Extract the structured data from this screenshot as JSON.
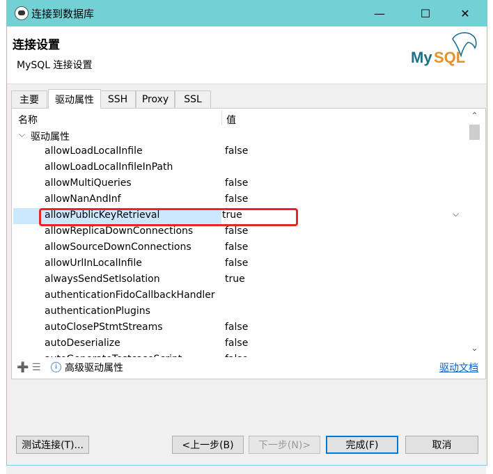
{
  "window": {
    "title": "连接到数据库",
    "minimize_icon": "minimize-icon",
    "maximize_icon": "maximize-icon",
    "close_icon": "close-icon",
    "titlebar_color": "#73d1d6"
  },
  "header": {
    "title": "连接设置",
    "subtitle": "MySQL 连接设置",
    "logo_text": "MySQL"
  },
  "tabs": [
    {
      "label": "主要",
      "active": false
    },
    {
      "label": "驱动属性",
      "active": true
    },
    {
      "label": "SSH",
      "active": false
    },
    {
      "label": "Proxy",
      "active": false
    },
    {
      "label": "SSL",
      "active": false
    }
  ],
  "table": {
    "columns": {
      "name": "名称",
      "value": "值"
    },
    "group": "驱动属性",
    "rows": [
      {
        "name": "allowLoadLocalInfile",
        "value": "false"
      },
      {
        "name": "allowLoadLocalInfileInPath",
        "value": ""
      },
      {
        "name": "allowMultiQueries",
        "value": "false"
      },
      {
        "name": "allowNanAndInf",
        "value": "false"
      },
      {
        "name": "allowPublicKeyRetrieval",
        "value": "true",
        "selected": true
      },
      {
        "name": "allowReplicaDownConnections",
        "value": "false"
      },
      {
        "name": "allowSourceDownConnections",
        "value": "false"
      },
      {
        "name": "allowUrlInLocalInfile",
        "value": "false"
      },
      {
        "name": "alwaysSendSetIsolation",
        "value": "true"
      },
      {
        "name": "authenticationFidoCallbackHandler",
        "value": ""
      },
      {
        "name": "authenticationPlugins",
        "value": ""
      },
      {
        "name": "autoClosePStmtStreams",
        "value": "false"
      },
      {
        "name": "autoDeserialize",
        "value": "false"
      },
      {
        "name": "autoGenerateTestcaseScript",
        "value": "false"
      }
    ]
  },
  "bottom_bar": {
    "advanced_label": "高级驱动属性",
    "docs_link": "驱动文档"
  },
  "buttons": {
    "test": "测试连接(T)...",
    "back": "<上一步(B)",
    "next": "下一步(N)>",
    "finish": "完成(F)",
    "cancel": "取消"
  },
  "accent": {
    "highlight_border": "#e8262a",
    "selection": "#cce8ff",
    "link": "#0b5fc4"
  }
}
